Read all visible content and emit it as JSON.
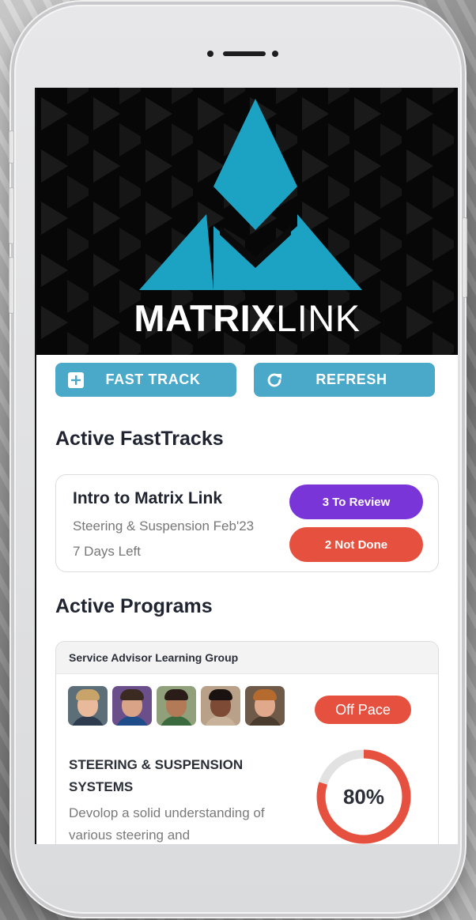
{
  "brand": {
    "name_bold": "MATRIX",
    "name_light": "LINK",
    "colors": {
      "accent": "#1ca3c3",
      "button": "#4aa8c8",
      "purple": "#7a35d9",
      "red": "#e6503f"
    }
  },
  "actions": {
    "fast_track": {
      "label": "FAST TRACK",
      "icon": "plus-square-icon"
    },
    "refresh": {
      "label": "REFRESH",
      "icon": "refresh-icon"
    }
  },
  "fasttracks": {
    "section_title": "Active FastTracks",
    "card": {
      "title": "Intro to Matrix Link",
      "subtitle": "Steering & Suspension Feb'23",
      "days_left": "7 Days Left",
      "review_label": "3 To Review",
      "not_done_label": "2 Not Done"
    }
  },
  "programs": {
    "section_title": "Active Programs",
    "card": {
      "group": "Service Advisor Learning Group",
      "status": "Off Pace",
      "title": "STEERING & SUSPENSION SYSTEMS",
      "description": "Devolop  a solid understanding of various steering and",
      "progress": 0.8,
      "progress_label": "80%",
      "members": [
        {
          "icon": "user-avatar-icon",
          "skin": "#e8b99a",
          "hair": "#c9a46a",
          "shirt": "#2f3b4f",
          "bg": "#5c6e78"
        },
        {
          "icon": "user-avatar-icon",
          "skin": "#d9a387",
          "hair": "#3a2a22",
          "shirt": "#1f4d8a",
          "bg": "#6b4f8a"
        },
        {
          "icon": "user-avatar-icon",
          "skin": "#b37a58",
          "hair": "#2a1c16",
          "shirt": "#3b6a3e",
          "bg": "#8fa07a"
        },
        {
          "icon": "user-avatar-icon",
          "skin": "#7d4b35",
          "hair": "#1a1210",
          "shirt": "#c9b29a",
          "bg": "#b9a089"
        },
        {
          "icon": "user-avatar-icon",
          "skin": "#e0a98b",
          "hair": "#b56a2e",
          "shirt": "#4a3b2f",
          "bg": "#6f5a4a"
        }
      ]
    }
  }
}
